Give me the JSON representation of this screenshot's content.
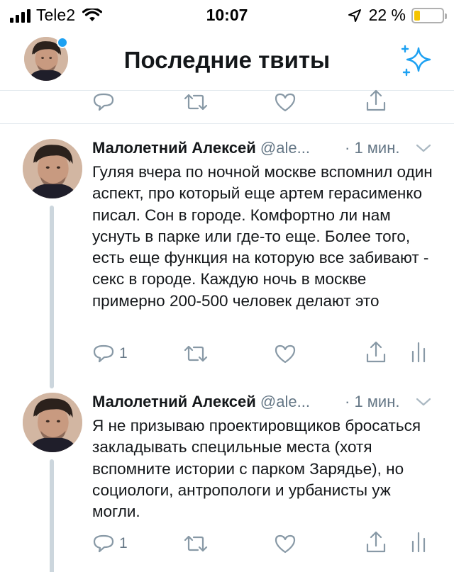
{
  "status_bar": {
    "carrier": "Tele2",
    "time": "10:07",
    "battery_percent": "22 %",
    "battery_level": 0.22
  },
  "header": {
    "title": "Последние твиты",
    "icons": [
      "avatar",
      "sparkle-icon"
    ]
  },
  "colors": {
    "accent": "#1da1f2",
    "icon_gray": "#8899a6",
    "divider": "#e1e8ed",
    "thread_line": "#ccd6dd",
    "battery": "#f5c400"
  },
  "tweets": [
    {
      "name": "Малолетний Алексей",
      "handle": "@ale...",
      "time": "· 1 мин.",
      "text": "Гуляя вчера по ночной москве вспомнил один аспект, про который еще артем герасименко писал. Сон в городе. Комфортно ли нам уснуть в парке или где-то еще. Более того, есть еще функция на которую все забивают - секс в городе. Каждую ночь в москве примерно 200-500 человек делают это",
      "reply_count": "1"
    },
    {
      "name": "Малолетний Алексей",
      "handle": "@ale...",
      "time": "· 1 мин.",
      "text": "Я не призываю проектировщиков бросаться закладывать специльные места (хотя вспомните истории с парком Зарядье), но социологи, антропологи и урбанисты уж могли.",
      "reply_count": "1"
    }
  ]
}
